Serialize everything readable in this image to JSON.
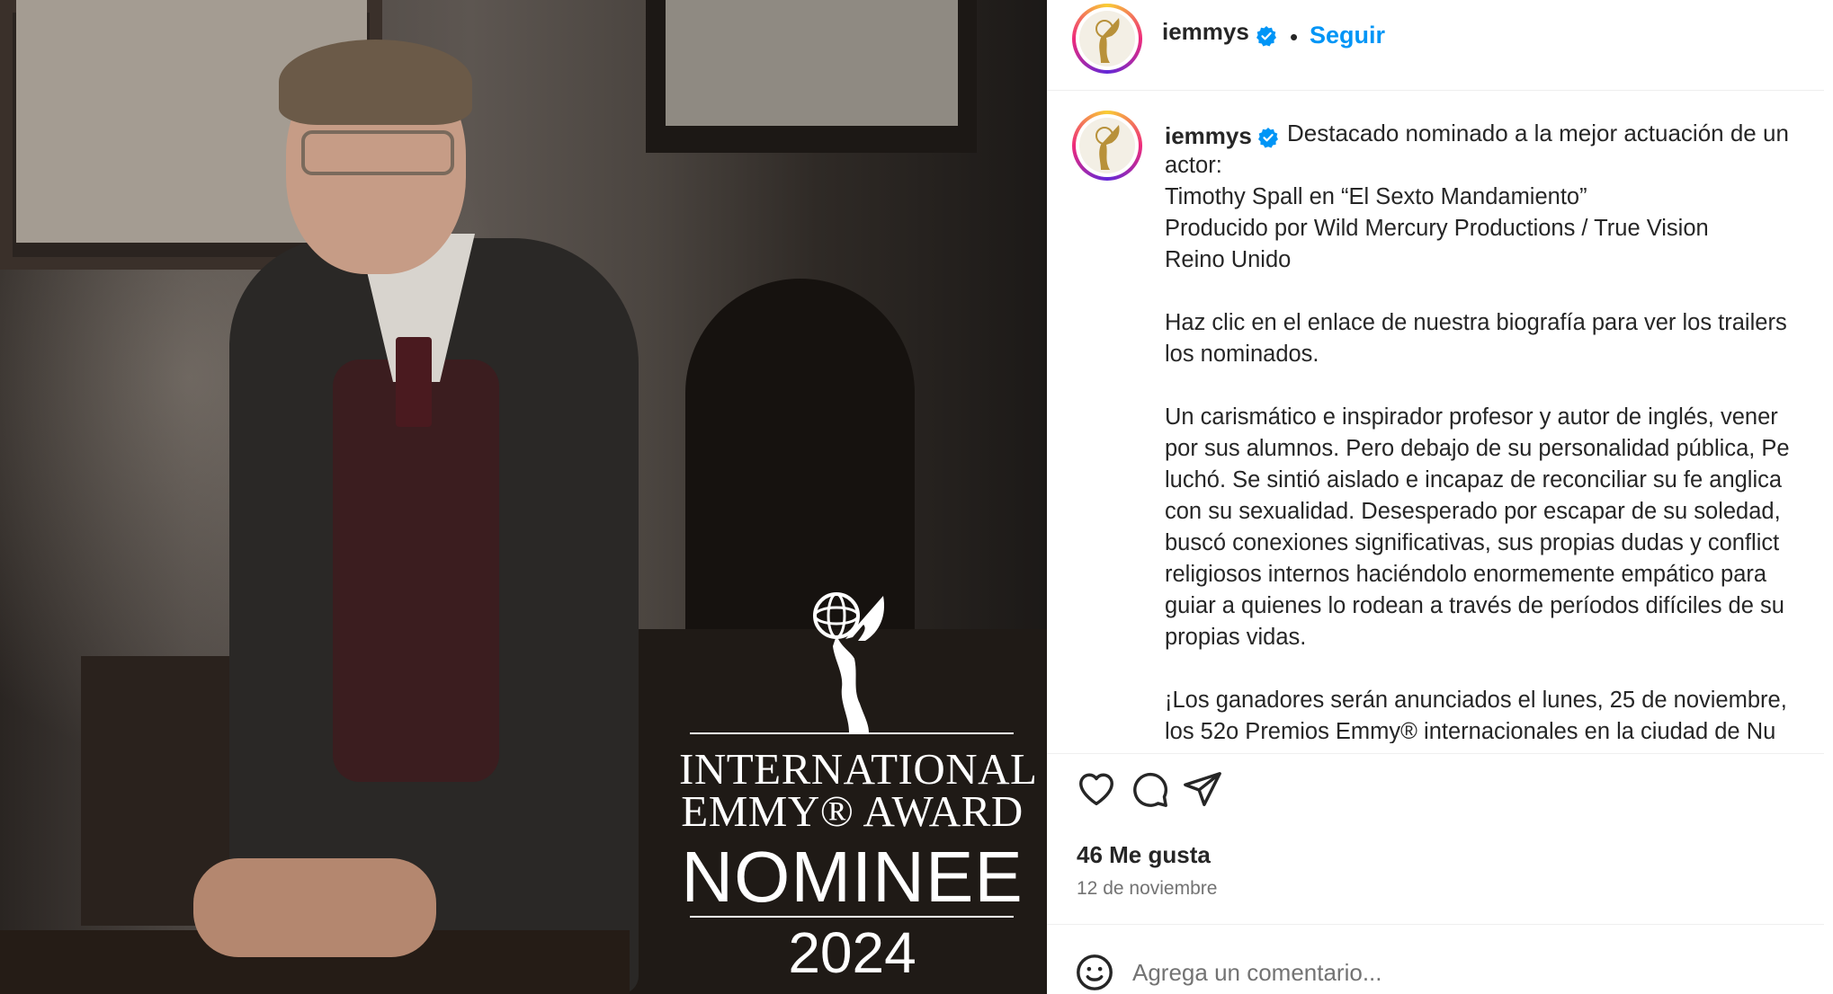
{
  "image": {
    "badge_line1": "INTERNATIONAL",
    "badge_line2": "EMMY® AWARD",
    "badge_line3": "NOMINEE",
    "badge_year": "2024"
  },
  "header": {
    "username": "iemmys",
    "separator": "•",
    "follow_label": "Seguir"
  },
  "caption": {
    "username": "iemmys",
    "first_line": "Destacado nominado a la mejor actuación de un",
    "lines": [
      "actor:",
      "Timothy Spall en “El Sexto Mandamiento”",
      "Producido por Wild Mercury Productions / True Vision",
      "Reino Unido",
      "",
      "Haz clic en el enlace de nuestra biografía para ver los trailers",
      "los nominados.",
      "",
      "Un carismático e inspirador profesor y autor de inglés, vener",
      "por sus alumnos. Pero debajo de su personalidad pública, Pe",
      "luchó. Se sintió aislado e incapaz de reconciliar su fe anglica",
      "con su sexualidad. Desesperado por escapar de su soledad,",
      "buscó conexiones significativas, sus propias dudas y conflict",
      "religiosos internos haciéndolo enormemente empático para",
      "guiar a quienes lo rodean a través de períodos difíciles de su",
      "propias vidas.",
      "",
      "¡Los ganadores serán anunciados el lunes, 25 de noviembre,",
      "los 52o Premios Emmy® internacionales en la ciudad de Nu"
    ]
  },
  "actions": {
    "like_icon": "heart-icon",
    "comment_icon": "comment-icon",
    "share_icon": "send-icon"
  },
  "stats": {
    "likes": "46 Me gusta",
    "date": "12 de noviembre"
  },
  "comment": {
    "placeholder": "Agrega un comentario...",
    "emoji_icon": "emoji-icon"
  },
  "colors": {
    "link": "#0095f6",
    "verified": "#0095f6",
    "text": "#262626",
    "muted": "#737373"
  }
}
